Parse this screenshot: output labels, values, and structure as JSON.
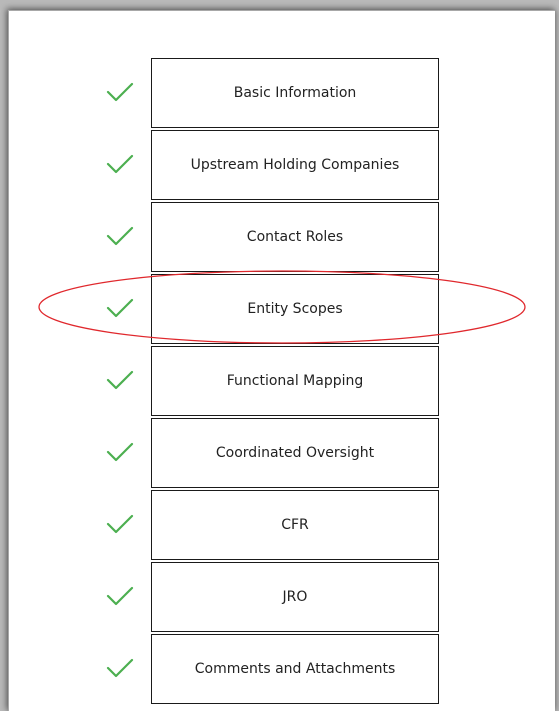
{
  "steps": [
    {
      "label": "Basic Information",
      "status": "complete"
    },
    {
      "label": "Upstream Holding Companies",
      "status": "complete"
    },
    {
      "label": "Contact Roles",
      "status": "complete"
    },
    {
      "label": "Entity Scopes",
      "status": "complete",
      "highlighted": true
    },
    {
      "label": "Functional Mapping",
      "status": "complete"
    },
    {
      "label": "Coordinated Oversight",
      "status": "complete"
    },
    {
      "label": "CFR",
      "status": "complete"
    },
    {
      "label": "JRO",
      "status": "complete"
    },
    {
      "label": "Comments and Attachments",
      "status": "complete"
    }
  ],
  "icons": {
    "check": "check-icon"
  },
  "colors": {
    "check": "#4caf50",
    "highlight_ellipse": "#e0282d",
    "box_border": "#1a1a1a",
    "background": "#b9b9b9"
  }
}
